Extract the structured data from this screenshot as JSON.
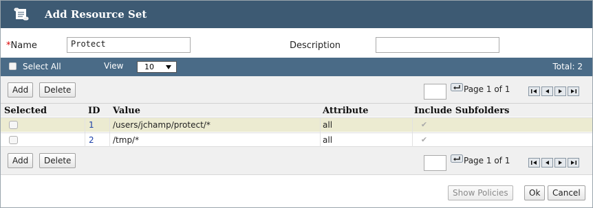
{
  "dialog": {
    "title": "Add Resource Set",
    "title_icon": "scroll-icon"
  },
  "form": {
    "name_required_mark": "*",
    "name_label": "Name",
    "name_value": "Protect",
    "description_label": "Description",
    "description_value": ""
  },
  "toolbar": {
    "select_all_label": "Select All",
    "view_label": "View",
    "view_value": "10",
    "total_label": "Total: 2"
  },
  "actions": {
    "add_label": "Add",
    "delete_label": "Delete"
  },
  "pager": {
    "page_input_value": "",
    "page_text": "Page 1 of 1",
    "icons": [
      "first-page-icon",
      "previous-page-icon",
      "next-page-icon",
      "last-page-icon"
    ]
  },
  "grid": {
    "columns": [
      "Selected",
      "ID",
      "Value",
      "Attribute",
      "Include Subfolders"
    ],
    "rows": [
      {
        "id": "1",
        "value": "/users/jchamp/protect/*",
        "attribute": "all",
        "include_subfolders": true,
        "selected": false
      },
      {
        "id": "2",
        "value": "/tmp/*",
        "attribute": "all",
        "include_subfolders": true,
        "selected": false
      }
    ],
    "highlight_color": "#ecebd1"
  },
  "footer": {
    "show_policies_label": "Show Policies",
    "ok_label": "Ok",
    "cancel_label": "Cancel"
  },
  "colors": {
    "title_bar": "#3d5a73",
    "toolbar_bar": "#4a6b87",
    "required": "#dd0000",
    "id_link": "#1a3fa8"
  }
}
